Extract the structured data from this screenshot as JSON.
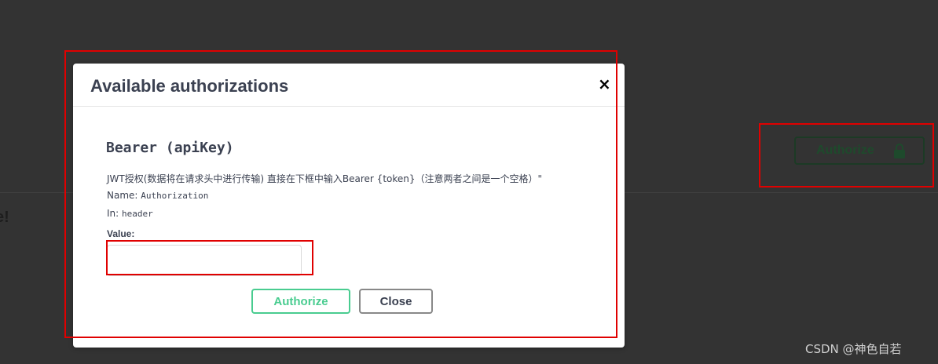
{
  "page": {
    "background_fragment": "e!"
  },
  "topbar": {
    "authorize_label": "Authorize",
    "lock_icon": "lock-icon"
  },
  "modal": {
    "title": "Available authorizations",
    "close_label": "×",
    "scheme": {
      "title": "Bearer (apiKey)",
      "description": "JWT授权(数据将在请求头中进行传输) 直接在下框中输入Bearer {token}（注意两者之间是一个空格）\"",
      "name_label": "Name:",
      "name_value": "Authorization",
      "in_label": "In:",
      "in_value": "header",
      "value_label": "Value:",
      "value_input": "",
      "value_placeholder": ""
    },
    "buttons": {
      "authorize_label": "Authorize",
      "close_label": "Close"
    }
  },
  "watermark": "CSDN @神色自若",
  "colors": {
    "background": "#333333",
    "accent_green": "#49cc90",
    "highlight_red": "#e00000",
    "text": "#3b4151"
  }
}
